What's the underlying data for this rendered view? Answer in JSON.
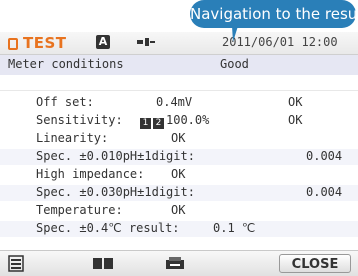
{
  "tooltip": {
    "text": "Navigation to the result"
  },
  "status_bar": {
    "app_tag": "TEST",
    "mode_badge": "A",
    "datetime": "2011/06/01 12:00"
  },
  "header": {
    "label": "Meter conditions",
    "value": "Good"
  },
  "rows": [
    {
      "label": "Off set:",
      "middle": "0.4mV",
      "right": "OK"
    },
    {
      "label": "Sensitivity:",
      "middle": "100.0%",
      "right": "OK"
    },
    {
      "label": "Linearity:",
      "middle": "OK",
      "right": ""
    },
    {
      "label": "Spec. ±0.010pH±1digit:",
      "middle": "",
      "right": "0.004"
    },
    {
      "label": "High impedance:",
      "middle": "OK",
      "right": ""
    },
    {
      "label": "Spec. ±0.030pH±1digit:",
      "middle": "",
      "right": "0.004"
    },
    {
      "label": "Temperature:",
      "middle": "OK",
      "right": ""
    },
    {
      "label": "Spec. ±0.4℃ result:",
      "middle": "0.1 ℃",
      "right": ""
    }
  ],
  "sensitivity_indicators": [
    "1",
    "2"
  ],
  "toolbar": {
    "close_label": "CLOSE",
    "icons": [
      "list-icon",
      "book-icon",
      "printer-icon"
    ]
  },
  "colors": {
    "accent_orange": "#e8731f",
    "tooltip_blue": "#2a7fb8",
    "header_bg": "#e6e7f3"
  }
}
